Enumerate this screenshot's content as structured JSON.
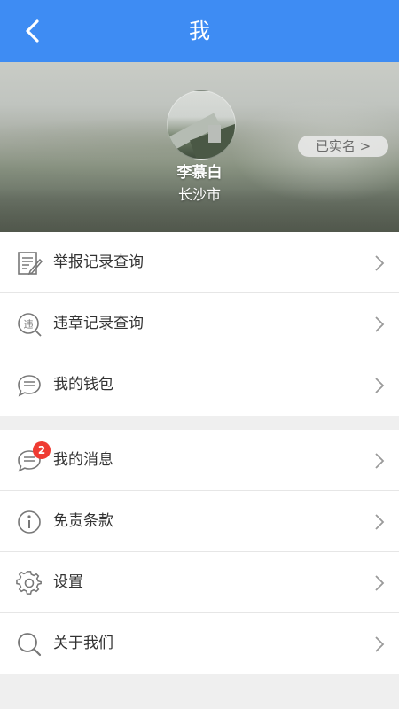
{
  "nav": {
    "title": "我",
    "back_icon": "back-arrow-icon"
  },
  "profile": {
    "name": "李慕白",
    "city": "长沙市",
    "verified_label": "已实名 >"
  },
  "menu_group_1": [
    {
      "label": "举报记录查询",
      "icon": "report-document-icon"
    },
    {
      "label": "违章记录查询",
      "icon": "violation-search-icon"
    },
    {
      "label": "我的钱包",
      "icon": "wallet-chat-icon"
    }
  ],
  "menu_group_2": [
    {
      "label": "我的消息",
      "icon": "message-icon",
      "badge": "2"
    },
    {
      "label": "免责条款",
      "icon": "info-icon"
    },
    {
      "label": "设置",
      "icon": "gear-icon"
    },
    {
      "label": "关于我们",
      "icon": "search-icon"
    }
  ],
  "colors": {
    "nav_bg": "#3e8cf3",
    "badge": "#ef3b32",
    "page_bg": "#efefef"
  }
}
